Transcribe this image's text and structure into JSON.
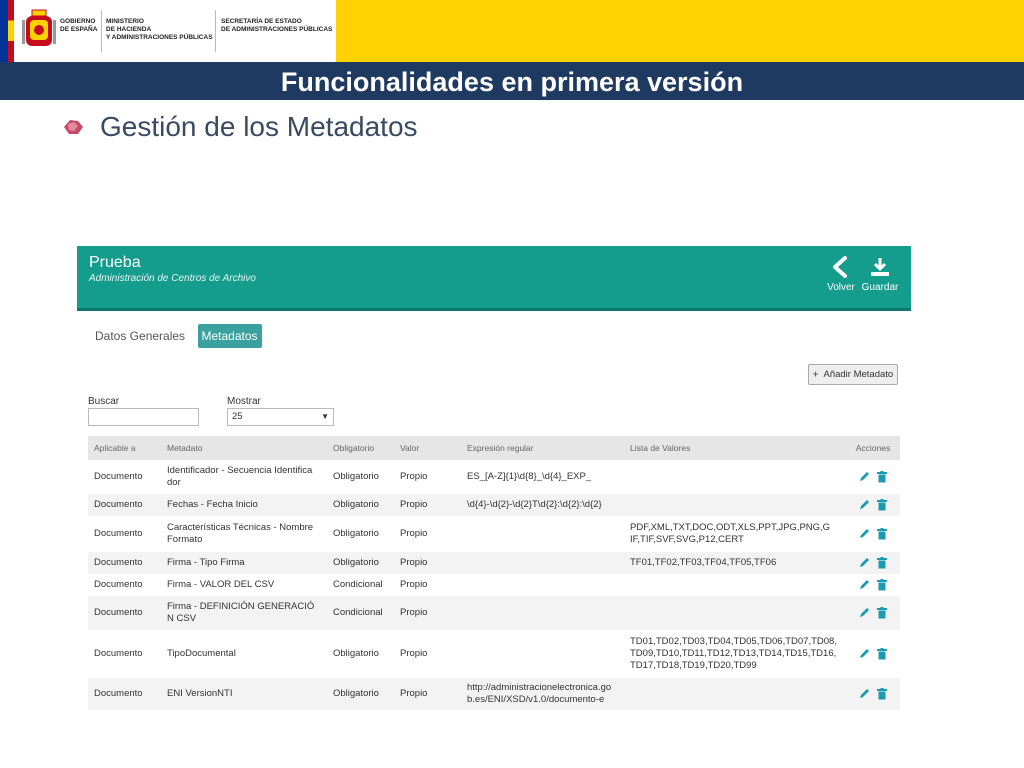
{
  "header": {
    "gov_line1": "Gobierno",
    "gov_line2": "de España",
    "min_line1": "Ministerio",
    "min_line2": "de Hacienda",
    "min_line3": "y Administraciones Públicas",
    "sec_line1": "Secretaría de Estado",
    "sec_line2": "de Administraciones Públicas"
  },
  "slide": {
    "title": "Funcionalidades en primera versión",
    "subtitle": "Gestión de los Metadatos"
  },
  "app": {
    "title": "Prueba",
    "subtitle": "Administración de Centros de Archivo",
    "back_label": "Volver",
    "save_label": "Guardar",
    "tabs": [
      {
        "label": "Datos Generales"
      },
      {
        "label": "Metadatos"
      }
    ],
    "add_button": "Añadir Metadato",
    "search_label": "Buscar",
    "show_label": "Mostrar",
    "show_value": "25",
    "columns": [
      "Aplicable a",
      "Metadato",
      "Obligatorio",
      "Valor",
      "Expresión regular",
      "Lista de Valores",
      "Acciones"
    ],
    "rows": [
      {
        "aplicable": "Documento",
        "metadato": "Identificador - Secuencia Identifica dor",
        "obligatorio": "Obligatorio",
        "valor": "Propio",
        "expresion": "ES_[A-Z]{1}\\d{8}_\\d{4}_EXP_",
        "lista": ""
      },
      {
        "aplicable": "Documento",
        "metadato": "Fechas - Fecha Inicio",
        "obligatorio": "Obligatorio",
        "valor": "Propio",
        "expresion": "\\d{4}-\\d{2}-\\d{2}T\\d{2}:\\d{2}:\\d{2}",
        "lista": ""
      },
      {
        "aplicable": "Documento",
        "metadato": "Características Técnicas - Nombre Formato",
        "obligatorio": "Obligatorio",
        "valor": "Propio",
        "expresion": "",
        "lista": "PDF,XML,TXT,DOC,ODT,XLS,PPT,JPG,PNG,G IF,TIF,SVF,SVG,P12,CERT"
      },
      {
        "aplicable": "Documento",
        "metadato": "Firma - Tipo Firma",
        "obligatorio": "Obligatorio",
        "valor": "Propio",
        "expresion": "",
        "lista": "TF01,TF02,TF03,TF04,TF05,TF06"
      },
      {
        "aplicable": "Documento",
        "metadato": "Firma - VALOR DEL CSV",
        "obligatorio": "Condicional",
        "valor": "Propio",
        "expresion": "",
        "lista": ""
      },
      {
        "aplicable": "Documento",
        "metadato": "Firma - DEFINICIÓN GENERACIÓ N CSV",
        "obligatorio": "Condicional",
        "valor": "Propio",
        "expresion": "",
        "lista": ""
      },
      {
        "aplicable": "Documento",
        "metadato": "TipoDocumental",
        "obligatorio": "Obligatorio",
        "valor": "Propio",
        "expresion": "",
        "lista": "TD01,TD02,TD03,TD04,TD05,TD06,TD07,TD08, TD09,TD10,TD11,TD12,TD13,TD14,TD15,TD16, TD17,TD18,TD19,TD20,TD99"
      },
      {
        "aplicable": "Documento",
        "metadato": "ENI VersionNTI",
        "obligatorio": "Obligatorio",
        "valor": "Propio",
        "expresion": "http://administracionelectronica.go b.es/ENI/XSD/v1.0/documento-e",
        "lista": ""
      }
    ]
  },
  "colors": {
    "gov_yellow": "#ffd100",
    "title_bar": "#1f3a60",
    "app_header": "#149c8c",
    "active_tab": "#3aa0a0",
    "action_icon": "#1a9bb0"
  }
}
